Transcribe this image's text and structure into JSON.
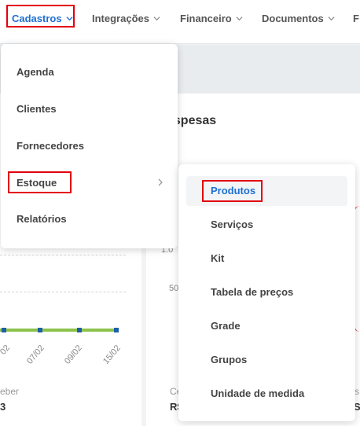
{
  "nav": {
    "items": [
      {
        "label": "Cadastros"
      },
      {
        "label": "Integrações"
      },
      {
        "label": "Financeiro"
      },
      {
        "label": "Documentos"
      },
      {
        "label": "F"
      }
    ]
  },
  "cadastros_menu": {
    "items": [
      {
        "label": "Agenda"
      },
      {
        "label": "Clientes"
      },
      {
        "label": "Fornecedores"
      },
      {
        "label": "Estoque"
      },
      {
        "label": "Relatórios"
      }
    ]
  },
  "estoque_submenu": {
    "items": [
      {
        "label": "Produtos"
      },
      {
        "label": "Serviços"
      },
      {
        "label": "Kit"
      },
      {
        "label": "Tabela de preços"
      },
      {
        "label": "Grade"
      },
      {
        "label": "Grupos"
      },
      {
        "label": "Unidade de medida"
      }
    ]
  },
  "dashboard": {
    "card_title": "espesas",
    "x_ticks": [
      "02",
      "07/02",
      "09/02",
      "15/02"
    ],
    "y_labels": [
      "1.0",
      "50"
    ],
    "left_footer_label": "eber",
    "left_footer_value": "3",
    "right_footer_label": "Ce",
    "right_footer_value": "R$",
    "right_footer_label2": "s",
    "right_footer_value2": "S"
  },
  "colors": {
    "accent": "#1f6fd1",
    "highlight_box": "#e3000f",
    "chart_line": "#8bc34a",
    "chart_point": "#1e5ea8"
  }
}
